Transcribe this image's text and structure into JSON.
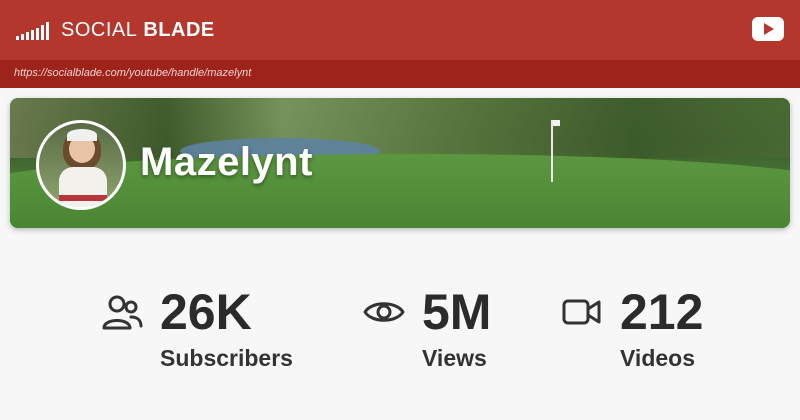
{
  "header": {
    "brand_light": "SOCIAL",
    "brand_bold": "BLADE",
    "brand_icon": "signal-bars-icon",
    "platform_icon": "youtube-icon",
    "url": "https://socialblade.com/youtube/handle/mazelynt"
  },
  "profile": {
    "channel_name": "Mazelynt",
    "banner": "golf-course-banner",
    "avatar": "avatar"
  },
  "stats": [
    {
      "value": "26K",
      "label": "Subscribers",
      "icon": "users-icon"
    },
    {
      "value": "5M",
      "label": "Views",
      "icon": "eye-icon"
    },
    {
      "value": "212",
      "label": "Videos",
      "icon": "video-camera-icon"
    }
  ],
  "colors": {
    "brand_red": "#b3372d",
    "url_bar_red": "#9e231b",
    "text_dark": "#2b2b2b",
    "background": "#f7f7f7"
  }
}
